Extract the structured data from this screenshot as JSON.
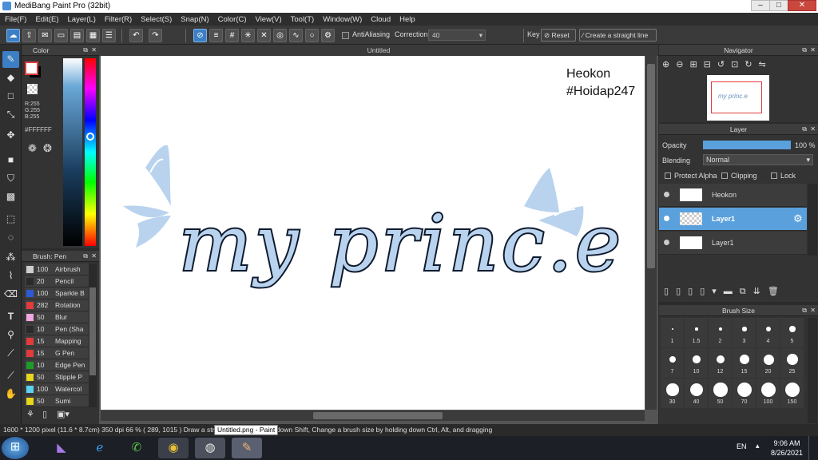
{
  "window": {
    "title": "MediBang Paint Pro (32bit)"
  },
  "menu": [
    "File(F)",
    "Edit(E)",
    "Layer(L)",
    "Filter(R)",
    "Select(S)",
    "Snap(N)",
    "Color(C)",
    "View(V)",
    "Tool(T)",
    "Window(W)",
    "Cloud",
    "Help"
  ],
  "toolbar": {
    "antialiasing_label": "AntiAliasing",
    "correction_label": "Correction",
    "correction_value": "40",
    "key_label": "Key",
    "reset_label": "Reset",
    "straight_line_label": "Create a straight line"
  },
  "color_panel": {
    "title": "Color",
    "r": "R:255",
    "g": "G:255",
    "b": "B:255",
    "hex": "#FFFFFF",
    "foreground": "#ffffff",
    "background": "#000000"
  },
  "brush_panel": {
    "title": "Brush: Pen",
    "brushes": [
      {
        "size": "100",
        "name": "Airbrush",
        "color": "#cfcfcf"
      },
      {
        "size": "20",
        "name": "Pencil",
        "color": "#2a2a2a"
      },
      {
        "size": "100",
        "name": "Sparkle B",
        "color": "#2d5bd6"
      },
      {
        "size": "282",
        "name": "Rotation",
        "color": "#e23b3b"
      },
      {
        "size": "50",
        "name": "Blur",
        "color": "#f4a6e0"
      },
      {
        "size": "10",
        "name": "Pen (Sha",
        "color": "#2a2a2a"
      },
      {
        "size": "15",
        "name": "Mapping",
        "color": "#e23b3b"
      },
      {
        "size": "15",
        "name": "G Pen",
        "color": "#e23b3b"
      },
      {
        "size": "10",
        "name": "Edge Pen",
        "color": "#1f9b2a"
      },
      {
        "size": "50",
        "name": "Stipple P",
        "color": "#e6d71e"
      },
      {
        "size": "100",
        "name": "Watercol",
        "color": "#5bd3f0"
      },
      {
        "size": "50",
        "name": "Sumi",
        "color": "#e6d71e"
      }
    ]
  },
  "canvas": {
    "tab": "Untitled",
    "text_line1": "Heokon",
    "text_line2": "#Hoidap247",
    "lettering": "my princ.e"
  },
  "navigator": {
    "title": "Navigator"
  },
  "layer_panel": {
    "title": "Layer",
    "opacity_label": "Opacity",
    "opacity_value": "100 %",
    "opacity_fraction": 1.0,
    "blending_label": "Blending",
    "blending_value": "Normal",
    "protect_alpha": "Protect Alpha",
    "clipping": "Clipping",
    "lock": "Lock",
    "layers": [
      {
        "name": "Heokon",
        "selected": false
      },
      {
        "name": "Layer1",
        "selected": true
      },
      {
        "name": "Layer1",
        "selected": false
      }
    ]
  },
  "brush_size": {
    "title": "Brush Size",
    "sizes": [
      "1",
      "1.5",
      "2",
      "3",
      "4",
      "5",
      "7",
      "10",
      "12",
      "15",
      "20",
      "25",
      "30",
      "40",
      "50",
      "70",
      "100",
      "150"
    ]
  },
  "status": {
    "text": "1600 * 1200 pixel  (11.6 * 8.7cm)  350 dpi  66 %  ( 289, 1015 )  Draw a straight line by holding down Shift, Change a brush size by holding down Ctrl, Alt, and dragging",
    "tooltip": "Untitled.png - Paint"
  },
  "taskbar": {
    "lang": "EN",
    "time": "9:06 AM",
    "date": "8/26/2021"
  },
  "colors": {
    "accent": "#3d7fc4",
    "lettering_fill": "#b9d3ee",
    "lettering_outline": "#0e1a2e"
  }
}
